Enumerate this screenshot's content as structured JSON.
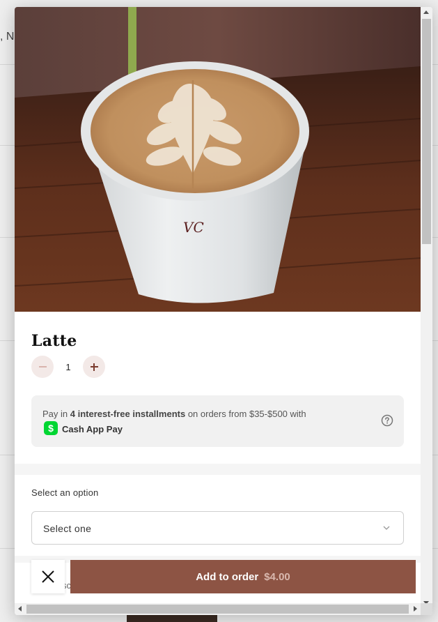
{
  "background": {
    "partial_text": ", N"
  },
  "product": {
    "title": "Latte",
    "quantity": "1",
    "image_alt": "latte-art-cup-photo",
    "cup_mark": "VC"
  },
  "payment": {
    "prefix": "Pay in ",
    "bold": "4 interest-free installments",
    "suffix": " on orders from $35-$500 with",
    "provider_logo": "$",
    "provider": "Cash App Pay",
    "help_icon": "question-circle-icon"
  },
  "options": {
    "label": "Select an option",
    "select_value": "Select one",
    "chevron_icon": "chevron-down-icon"
  },
  "footer": {
    "close_icon": "close-icon",
    "add_label": "Add to order",
    "price": "$4.00",
    "faded_text": "sc"
  },
  "colors": {
    "accent": "#8d5444",
    "accent_light": "#f3e9e7",
    "cashapp_green": "#00d632"
  }
}
